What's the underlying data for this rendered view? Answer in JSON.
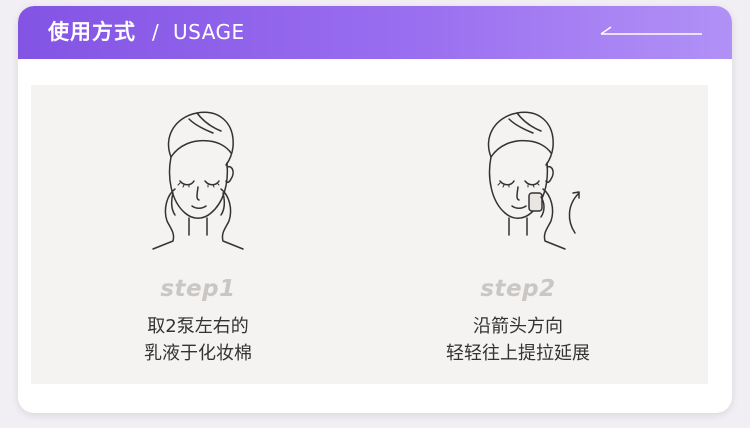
{
  "header": {
    "title": "使用方式",
    "separator": "/",
    "subtitle": "USAGE",
    "arrow_icon": "long-left-arrow-icon"
  },
  "steps": [
    {
      "label": "step1",
      "line1": "取2泵左右的",
      "line2": "乳液于化妆棉",
      "icon": "face-towel-hands-icon"
    },
    {
      "label": "step2",
      "line1": "沿箭头方向",
      "line2": "轻轻往上提拉延展",
      "icon": "face-towel-cotton-pad-icon"
    }
  ],
  "colors": {
    "header_start": "#8354e4",
    "header_end": "#b191f6",
    "panel_bg": "#f4f3f1",
    "step_label": "#c9c6c4",
    "body_text": "#333333"
  }
}
